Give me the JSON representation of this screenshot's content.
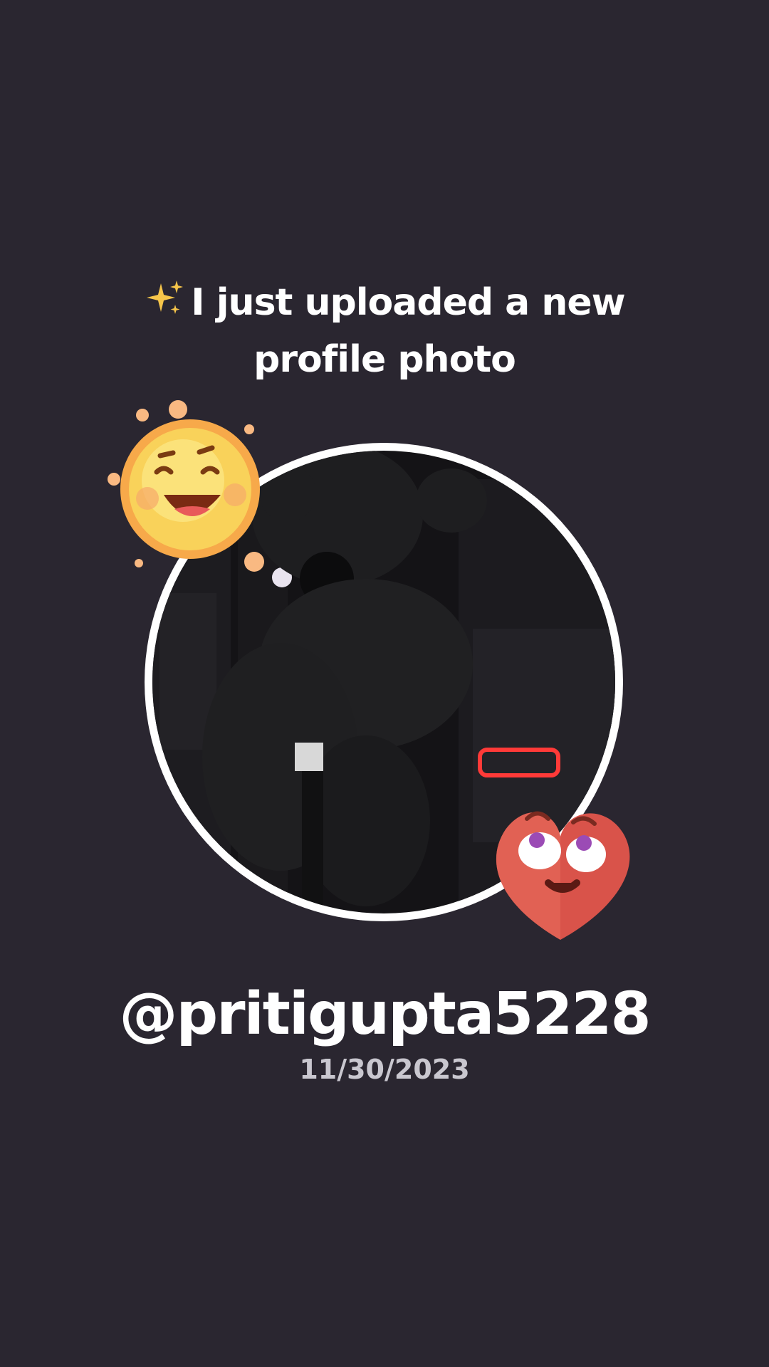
{
  "headline": {
    "sparkle_icon": "sparkles-icon",
    "text": "I just uploaded a new profile photo"
  },
  "avatar": {
    "description_icon": "profile-photo"
  },
  "stickers": {
    "sun": "laughing-sun-sticker",
    "heart": "eye-rolling-heart-sticker"
  },
  "profile": {
    "username": "@pritigupta5228",
    "date": "11/30/2023"
  },
  "colors": {
    "background": "#2a2630",
    "text": "#ffffff",
    "date_text": "#c9c7cf",
    "avatar_border": "#ffffff",
    "sun": "#f7c948",
    "heart": "#d9534a"
  }
}
